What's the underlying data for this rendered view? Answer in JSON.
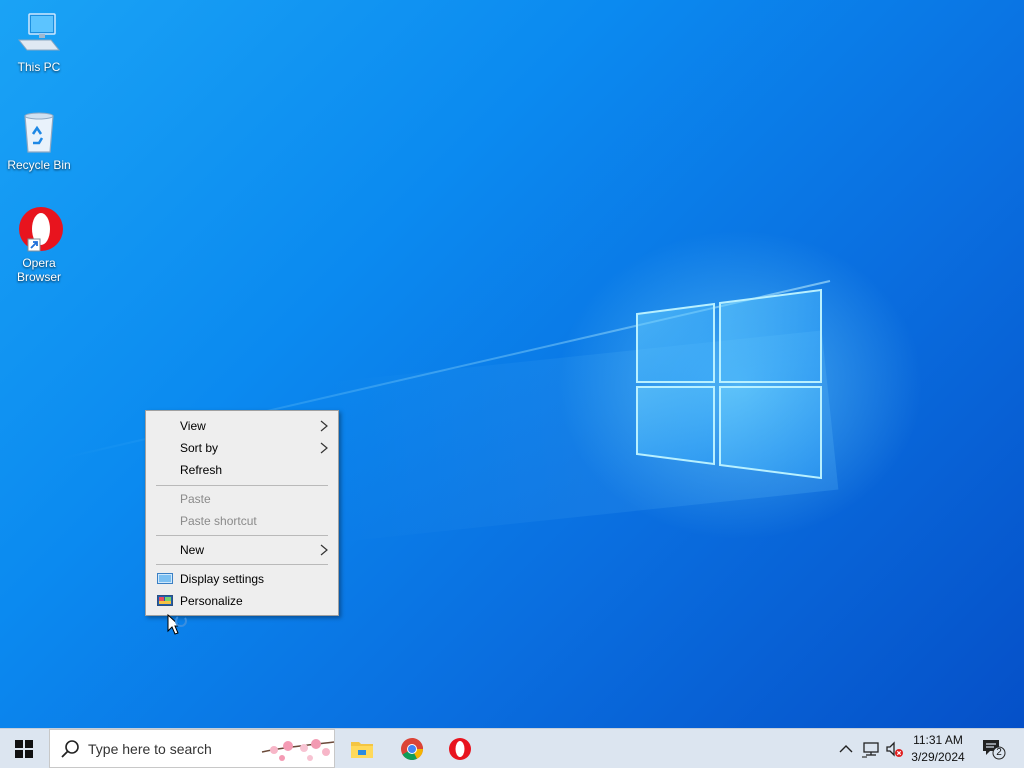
{
  "desktop": {
    "icons": [
      {
        "label": "This PC",
        "icon": "computer-icon"
      },
      {
        "label": "Recycle Bin",
        "icon": "recycle-bin-icon"
      },
      {
        "label": "Opera Browser",
        "icon": "opera-icon"
      }
    ]
  },
  "context_menu": {
    "items": [
      {
        "label": "View",
        "has_submenu": true,
        "enabled": true
      },
      {
        "label": "Sort by",
        "has_submenu": true,
        "enabled": true
      },
      {
        "label": "Refresh",
        "has_submenu": false,
        "enabled": true
      },
      {
        "label": "Paste",
        "has_submenu": false,
        "enabled": false
      },
      {
        "label": "Paste shortcut",
        "has_submenu": false,
        "enabled": false
      },
      {
        "label": "New",
        "has_submenu": true,
        "enabled": true
      },
      {
        "label": "Display settings",
        "has_submenu": false,
        "enabled": true,
        "icon": "display-settings-icon"
      },
      {
        "label": "Personalize",
        "has_submenu": false,
        "enabled": true,
        "icon": "personalize-icon"
      }
    ]
  },
  "taskbar": {
    "search_placeholder": "Type here to search",
    "pinned_apps": [
      "file-explorer-icon",
      "chrome-icon",
      "opera-icon"
    ],
    "tray": {
      "icons": [
        "chevron-up-icon",
        "network-icon",
        "volume-muted-icon"
      ],
      "time": "11:31 AM",
      "date": "3/29/2024",
      "notification_count": "2"
    }
  },
  "colors": {
    "desktop_blue": "#0b8af0",
    "taskbar_bg": "#dce5f0",
    "menu_bg": "#eeeeee",
    "opera_red": "#e8141e"
  }
}
